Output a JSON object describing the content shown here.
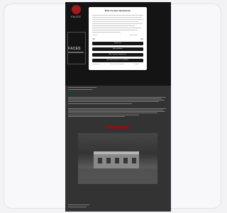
{
  "site": {
    "logo_text": "FACES",
    "hero_text": "FACES"
  },
  "cookie_dialog": {
    "title": "Bitte Cookies akzeptieren",
    "links": [
      "Details",
      "Datenschutz"
    ],
    "buttons": [
      "Speichern",
      "Alle ablehnen",
      "Alle Cookies akzeptieren",
      "Auswahl speichern & schließen"
    ],
    "footer_links": [
      "Impressum",
      "Datenschutzerklärung",
      "Cookies"
    ]
  }
}
